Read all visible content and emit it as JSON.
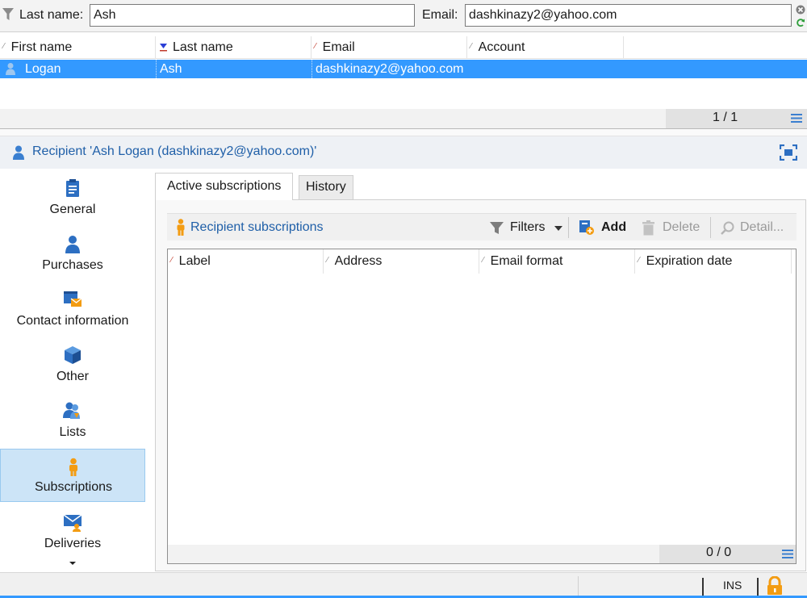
{
  "filter": {
    "last_name_label": "Last name:",
    "last_name_value": "Ash",
    "email_label": "Email:",
    "email_value": "dashkinazy2@yahoo.com"
  },
  "grid": {
    "columns": [
      "First name",
      "Last name",
      "Email",
      "Account"
    ],
    "rows": [
      {
        "first_name": "Logan",
        "last_name": "Ash",
        "email": "dashkinazy2@yahoo.com",
        "account": ""
      }
    ],
    "pager": "1 / 1"
  },
  "recipient": {
    "title": "Recipient 'Ash Logan (dashkinazy2@yahoo.com)'"
  },
  "sidenav": {
    "items": [
      {
        "label": "General"
      },
      {
        "label": "Purchases"
      },
      {
        "label": "Contact information"
      },
      {
        "label": "Other"
      },
      {
        "label": "Lists"
      },
      {
        "label": "Subscriptions"
      },
      {
        "label": "Deliveries"
      }
    ],
    "active": "Subscriptions"
  },
  "tabs": {
    "active": "Active subscriptions",
    "other": "History"
  },
  "toolbar": {
    "title": "Recipient subscriptions",
    "filters": "Filters",
    "add": "Add",
    "delete": "Delete",
    "detail": "Detail..."
  },
  "subgrid": {
    "columns": [
      "Label",
      "Address",
      "Email format",
      "Expiration date"
    ],
    "pager": "0 / 0"
  },
  "status": {
    "mode": "INS"
  },
  "colors": {
    "selection": "#3399ff",
    "accent_blue": "#1f5fa8",
    "orange": "#f39c12"
  }
}
